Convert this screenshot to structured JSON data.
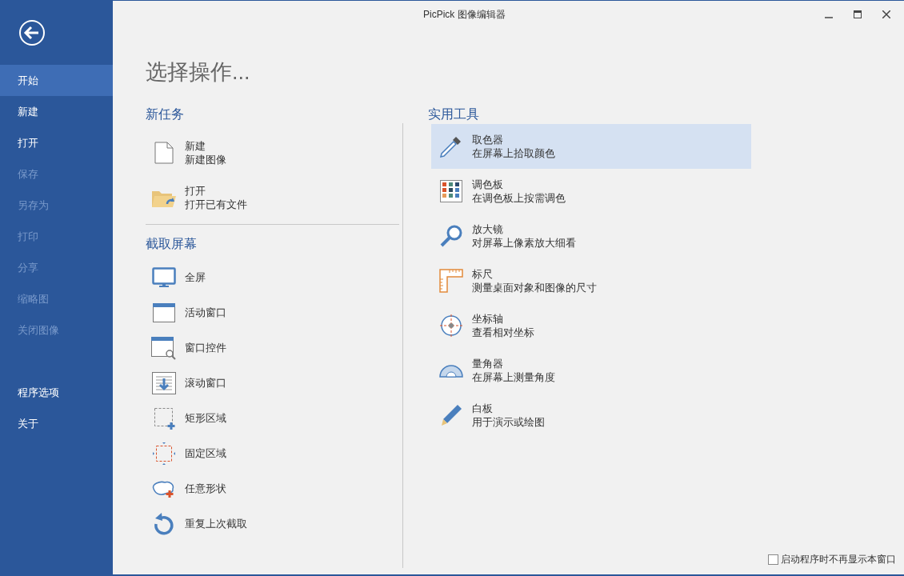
{
  "window": {
    "title": "PicPick 图像编辑器"
  },
  "sidebar": {
    "items": [
      {
        "label": "开始",
        "selected": true,
        "disabled": false
      },
      {
        "label": "新建",
        "selected": false,
        "disabled": false
      },
      {
        "label": "打开",
        "selected": false,
        "disabled": false
      },
      {
        "label": "保存",
        "selected": false,
        "disabled": true
      },
      {
        "label": "另存为",
        "selected": false,
        "disabled": true
      },
      {
        "label": "打印",
        "selected": false,
        "disabled": true
      },
      {
        "label": "分享",
        "selected": false,
        "disabled": true
      },
      {
        "label": "缩略图",
        "selected": false,
        "disabled": true
      },
      {
        "label": "关闭图像",
        "selected": false,
        "disabled": true
      }
    ],
    "footer_items": [
      {
        "label": "程序选项",
        "selected": false,
        "disabled": false
      },
      {
        "label": "关于",
        "selected": false,
        "disabled": false
      }
    ]
  },
  "heading": "选择操作...",
  "new_task": {
    "title": "新任务",
    "items": [
      {
        "label": "新建",
        "description": "新建图像"
      },
      {
        "label": "打开",
        "description": "打开已有文件"
      }
    ]
  },
  "capture": {
    "title": "截取屏幕",
    "items": [
      {
        "label": "全屏"
      },
      {
        "label": "活动窗口"
      },
      {
        "label": "窗口控件"
      },
      {
        "label": "滚动窗口"
      },
      {
        "label": "矩形区域"
      },
      {
        "label": "固定区域"
      },
      {
        "label": "任意形状"
      },
      {
        "label": "重复上次截取"
      }
    ]
  },
  "tools": {
    "title": "实用工具",
    "items": [
      {
        "label": "取色器",
        "description": "在屏幕上拾取颜色",
        "selected": true
      },
      {
        "label": "调色板",
        "description": "在调色板上按需调色",
        "selected": false
      },
      {
        "label": "放大镜",
        "description": "对屏幕上像素放大细看",
        "selected": false
      },
      {
        "label": "标尺",
        "description": "测量桌面对象和图像的尺寸",
        "selected": false
      },
      {
        "label": "坐标轴",
        "description": "查看相对坐标",
        "selected": false
      },
      {
        "label": "量角器",
        "description": "在屏幕上测量角度",
        "selected": false
      },
      {
        "label": "白板",
        "description": "用于演示或绘图",
        "selected": false
      }
    ]
  },
  "startup_checkbox": {
    "label": "启动程序时不再显示本窗口",
    "checked": false
  }
}
